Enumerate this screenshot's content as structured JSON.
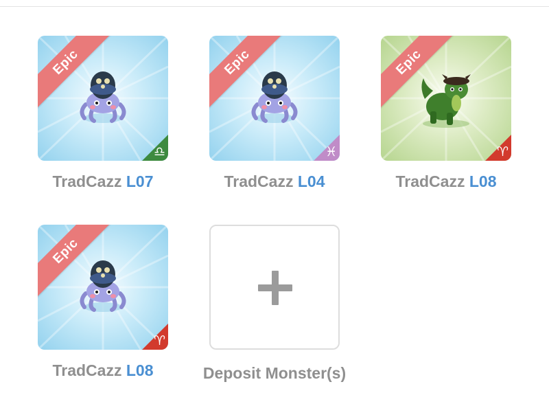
{
  "monsters": [
    {
      "badge": "Epic",
      "name": "TradCazz",
      "level": "L07",
      "zodiac_symbol": "♎",
      "zodiac_name": "libra",
      "zodiac_color": "#3d8a3f",
      "bg": "blue",
      "creature": "octopus"
    },
    {
      "badge": "Epic",
      "name": "TradCazz",
      "level": "L04",
      "zodiac_symbol": "♓",
      "zodiac_name": "pisces",
      "zodiac_color": "#c08cc8",
      "bg": "blue",
      "creature": "octopus"
    },
    {
      "badge": "Epic",
      "name": "TradCazz",
      "level": "L08",
      "zodiac_symbol": "♈",
      "zodiac_name": "aries",
      "zodiac_color": "#d23a2d",
      "bg": "green",
      "creature": "dragon"
    },
    {
      "badge": "Epic",
      "name": "TradCazz",
      "level": "L08",
      "zodiac_symbol": "♈",
      "zodiac_name": "aries",
      "zodiac_color": "#d23a2d",
      "bg": "blue",
      "creature": "octopus"
    }
  ],
  "deposit": {
    "label": "Deposit Monster(s)",
    "icon": "plus-icon"
  },
  "colors": {
    "ribbon": "#e97a7a",
    "name_text": "#8f8f8f",
    "level_text": "#4a8fd2",
    "sky_bg": "#a8dcf2",
    "grass_bg": "#c3dea0"
  }
}
